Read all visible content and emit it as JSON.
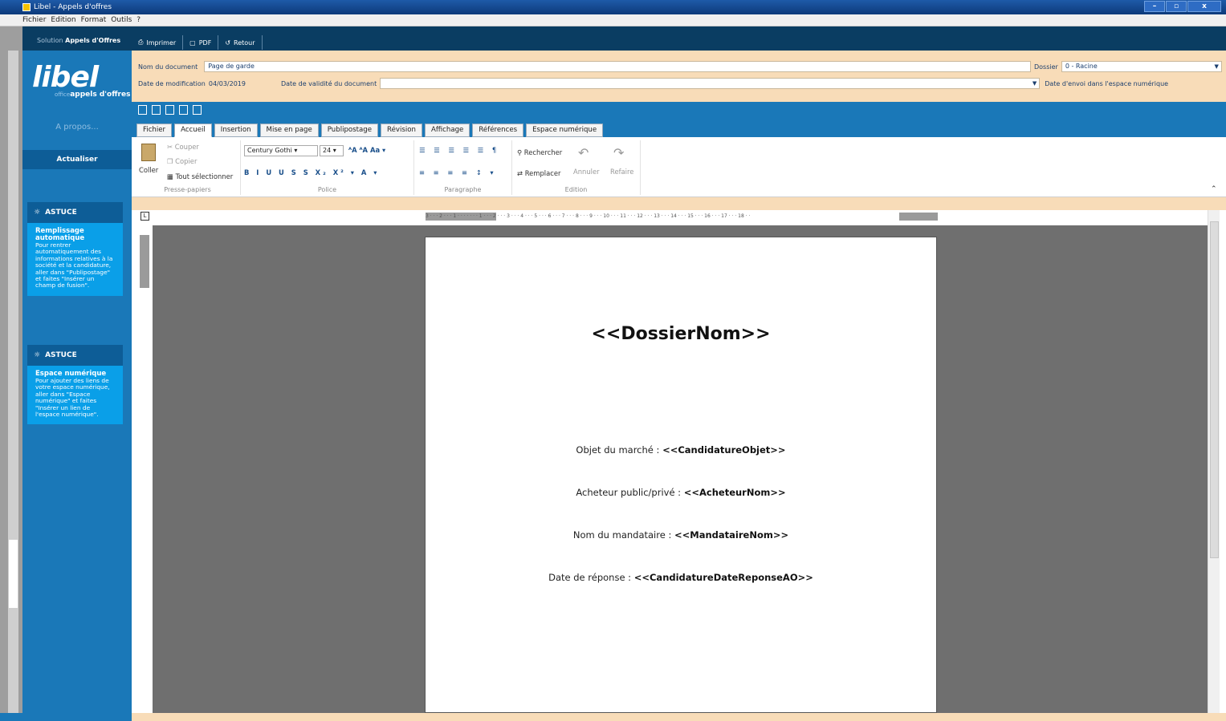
{
  "window": {
    "title": "Libel - Appels d'offres",
    "min": "–",
    "max": "▫",
    "close": "x"
  },
  "menu": [
    "Fichier",
    "Edition",
    "Format",
    "Outils",
    "?"
  ],
  "solution": {
    "prefix": "Solution",
    "name": "Appels d'Offres"
  },
  "toolbar": {
    "print": "Imprimer",
    "pdf": "PDF",
    "back": "Retour"
  },
  "sidebar": {
    "logo_word": "libel",
    "logo_sub_small": "office",
    "logo_sub": "appels d'offres",
    "about": "A propos...",
    "refresh": "Actualiser",
    "tips": [
      {
        "header": "ASTUCE",
        "title": "Remplissage automatique",
        "body": "Pour rentrer automatiquement des informations relatives à la société et la candidature, aller dans \"Publipostage\" et faites \"Insérer un champ de fusion\"."
      },
      {
        "header": "ASTUCE",
        "title": "Espace numérique",
        "body": "Pour ajouter des liens de votre espace numérique, aller dans \"Espace numérique\" et faites \"Insérer un lien de l'espace numérique\"."
      }
    ]
  },
  "form": {
    "doc_name_label": "Nom du document",
    "doc_name_value": "Page de garde",
    "folder_label": "Dossier",
    "folder_value": "0 - Racine",
    "modified_label": "Date de modification",
    "modified_value": "04/03/2019",
    "validity_label": "Date de validité du document",
    "validity_value": "",
    "sent_label": "Date d'envoi dans l'espace numérique"
  },
  "tabs": [
    "Fichier",
    "Accueil",
    "Insertion",
    "Mise en page",
    "Publipostage",
    "Révision",
    "Affichage",
    "Références",
    "Espace numérique"
  ],
  "active_tab": "Accueil",
  "ribbon": {
    "clipboard": {
      "paste": "Coller",
      "cut": "Couper",
      "copy": "Copier",
      "select_all": "Tout sélectionner",
      "caption": "Presse-papiers"
    },
    "font": {
      "family": "Century Gothi",
      "size": "24",
      "caption": "Police"
    },
    "paragraph": {
      "caption": "Paragraphe"
    },
    "edition": {
      "find": "Rechercher",
      "replace": "Remplacer",
      "undo": "Annuler",
      "redo": "Refaire",
      "caption": "Edition"
    }
  },
  "ruler_corner": "L",
  "ruler_h": "3 · · · 2 · · · 1 · · · · · · · 1 · · · 2 · · · 3 · · · 4 · · · 5 · · · 6 · · · 7 · · · 8 · · · 9 · · · 10 · · · 11 · · · 12 · · · 13 · · · 14 · · · 15 · · · 16 · · · 17 · · · 18 · ·",
  "document": {
    "title": "<<DossierNom>>",
    "lines": [
      {
        "label": "Objet du marché : ",
        "field": "<<CandidatureObjet>>"
      },
      {
        "label": "Acheteur public/privé : ",
        "field": "<<AcheteurNom>>"
      },
      {
        "label": "Nom du mandataire : ",
        "field": "<<MandataireNom>>"
      },
      {
        "label": "Date de réponse : ",
        "field": "<<CandidatureDateReponseAO>>"
      }
    ]
  },
  "colors": {
    "sidebar": "#1a78b8",
    "form_bg": "#f8dcb8",
    "tip_body": "#0a9fe8",
    "dark_bar": "#0a3d62"
  }
}
